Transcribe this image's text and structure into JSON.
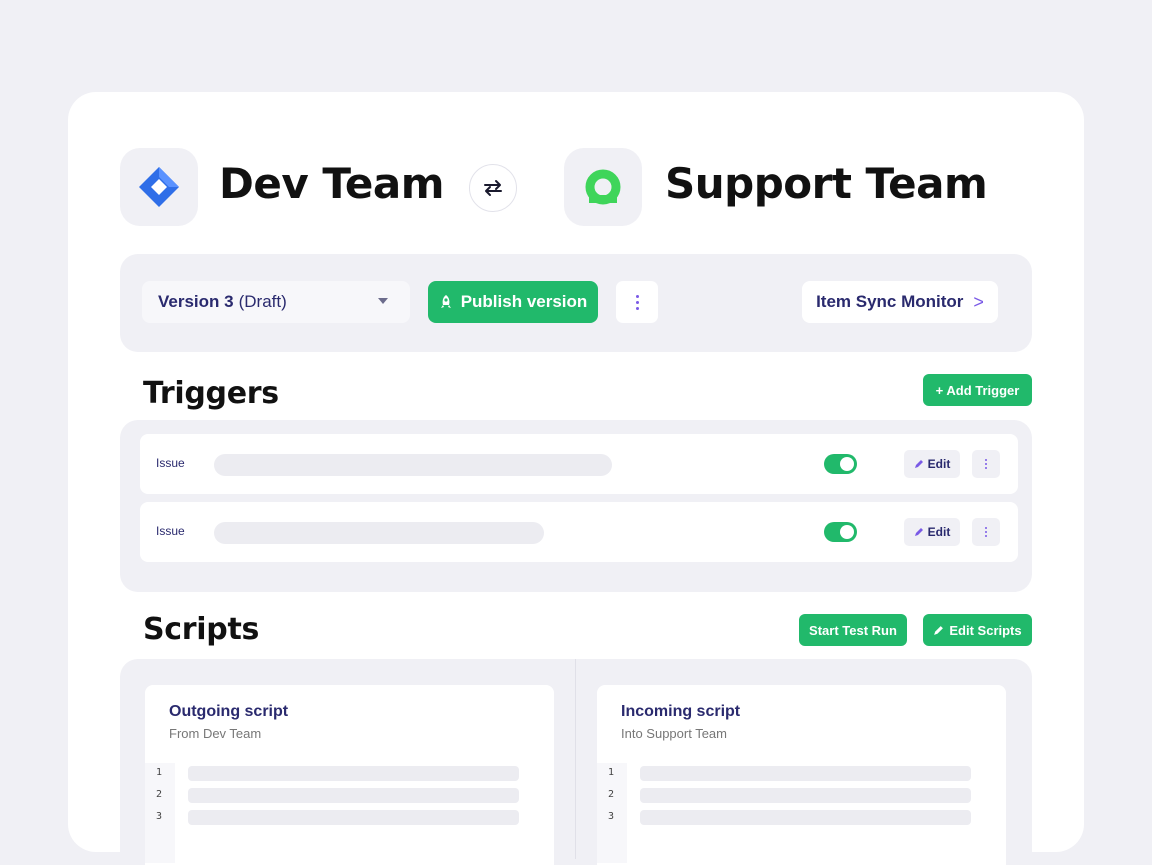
{
  "header": {
    "source_team": "Dev Team",
    "target_team": "Support Team",
    "source_icon": "jira-diamond-icon",
    "target_icon": "support-ring-icon",
    "swap_icon": "swap-arrows-icon"
  },
  "toolbar": {
    "version_label": "Version 3",
    "version_status": "(Draft)",
    "publish_label": "Publish version",
    "publish_icon": "rocket-icon",
    "sync_label": "Item Sync Monitor",
    "sync_chevron": ">"
  },
  "triggers": {
    "title": "Triggers",
    "add_label": "+ Add Trigger",
    "rows": [
      {
        "type": "Issue",
        "enabled": true,
        "edit_label": "Edit"
      },
      {
        "type": "Issue",
        "enabled": true,
        "edit_label": "Edit"
      }
    ]
  },
  "scripts": {
    "title": "Scripts",
    "test_run_label": "Start Test Run",
    "edit_label": "Edit Scripts",
    "outgoing": {
      "title": "Outgoing script",
      "subtitle": "From Dev Team",
      "line_numbers": [
        "1",
        "2",
        "3"
      ]
    },
    "incoming": {
      "title": "Incoming script",
      "subtitle": "Into Support Team",
      "line_numbers": [
        "1",
        "2",
        "3"
      ]
    }
  },
  "colors": {
    "background": "#f0f0f5",
    "accent_green": "#21b96b",
    "text_navy": "#2a2a6e",
    "icon_purple": "#7a5ae6",
    "jira_blue": "#2f6ee8",
    "support_green": "#3fd55a"
  }
}
